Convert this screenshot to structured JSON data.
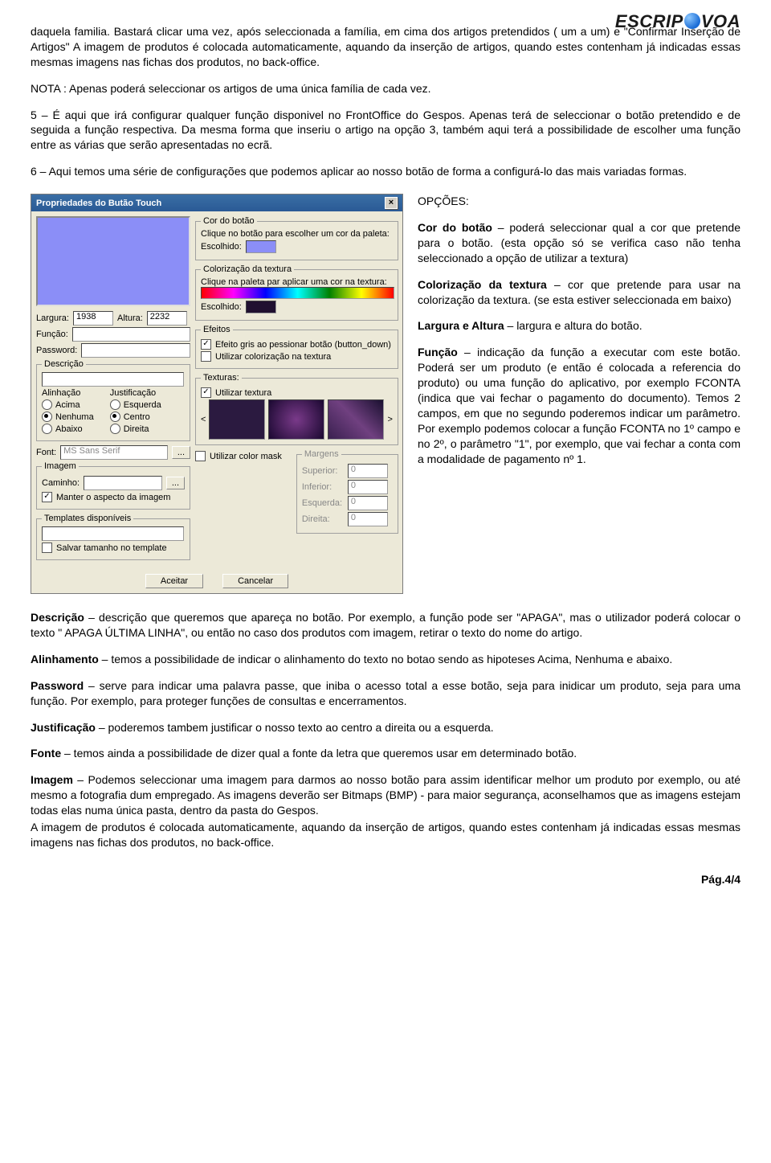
{
  "logo": "ESCRIPOVOA",
  "intro_p1": "daquela familia. Bastará clicar uma vez, após seleccionada a família, em cima dos artigos pretendidos ( um a um) e \"Confirmar Inserção de Artigos\" A imagem de produtos é colocada automaticamente, aquando da inserção de artigos, quando estes contenham já indicadas essas mesmas imagens nas fichas dos produtos, no back-office.",
  "nota": "NOTA : Apenas poderá seleccionar os artigos de uma única família de cada vez.",
  "p5": "5 – É aqui que irá configurar qualquer função disponivel no FrontOffice do Gespos. Apenas terá de seleccionar o botão pretendido e de seguida a função respectiva. Da mesma forma que inseriu o artigo na opção 3, também aqui terá a possibilidade de escolher uma função entre as várias que serão apresentadas no ecrã.",
  "p6": "6 – Aqui temos uma série de configurações que podemos aplicar ao nosso botão de forma a configurá-lo das mais variadas formas.",
  "opcoes_title": "OPÇÕES:",
  "opt_cor_t": "Cor do botão",
  "opt_cor": " – poderá seleccionar qual a cor que pretende para o botão. (esta opção só se verifica caso não tenha seleccionado a opção de utilizar a textura)",
  "opt_col_t": "Colorização da textura",
  "opt_col": " – cor que pretende para usar na colorização da textura. (se esta estiver seleccionada em baixo)",
  "opt_la_t": "Largura e Altura",
  "opt_la": " – largura e altura do botão.",
  "opt_fn_t": "Função",
  "opt_fn": " – indicação da função a executar com este botão. Poderá ser um produto (e então é colocada a referencia do produto) ou uma função do aplicativo, por exemplo FCONTA (indica que vai fechar o pagamento do documento). Temos 2 campos, em que no segundo poderemos indicar um parâmetro. Por exemplo podemos colocar a função FCONTA no 1º campo e no 2º, o parâmetro \"1\", por exemplo, que vai fechar a conta com a modalidade de pagamento nº 1.",
  "desc_t": "Descrição",
  "desc": " – descrição que queremos que apareça no botão. Por exemplo, a função pode ser \"APAGA\", mas o utilizador poderá colocar o texto \" APAGA ÚLTIMA LINHA\", ou então no caso dos produtos com imagem, retirar o texto do nome do artigo.",
  "ali_t": "Alinhamento",
  "ali": " – temos a possibilidade de indicar o alinhamento do texto no botao sendo as hipoteses Acima, Nenhuma e abaixo.",
  "pw_t": "Password",
  "pw": " – serve para indicar uma palavra passe, que iniba o acesso total a esse botão, seja para inidicar um produto, seja para uma função. Por exemplo, para proteger funções de consultas e encerramentos.",
  "just_t": "Justificação",
  "just": " – poderemos tambem justificar o nosso texto ao centro a direita ou a esquerda.",
  "font_t": "Fonte",
  "font": " – temos ainda a possibilidade de dizer qual a fonte da letra que queremos usar em determinado botão.",
  "img_t": "Imagem",
  "img1": " – Podemos seleccionar uma imagem para darmos ao nosso botão para assim identificar melhor um produto por exemplo, ou até mesmo a fotografia dum empregado. As imagens deverão ser Bitmaps (BMP) - para maior segurança, aconselhamos que as imagens estejam todas elas numa única pasta, dentro da pasta do Gespos.",
  "img2": "A imagem de produtos é colocada automaticamente, aquando da inserção de artigos, quando estes contenham já indicadas essas mesmas imagens nas fichas dos produtos, no back-office.",
  "pager": "Pág.4/4",
  "dialog": {
    "title": "Propriedades do Butão Touch",
    "largura_l": "Largura:",
    "largura_v": "1938",
    "altura_l": "Altura:",
    "altura_v": "2232",
    "funcao_l": "Função:",
    "password_l": "Password:",
    "descricao_l": "Descrição",
    "alinh_l": "Alinhação",
    "just_l": "Justificação",
    "r_acima": "Acima",
    "r_nenhuma": "Nenhuma",
    "r_abaixo": "Abaixo",
    "r_esq": "Esquerda",
    "r_centro": "Centro",
    "r_dir": "Direita",
    "font_l": "Font:",
    "font_v": "MS Sans Serif",
    "imagem_l": "Imagem",
    "caminho_l": "Caminho:",
    "manter": "Manter o aspecto da imagem",
    "cmask": "Utilizar color mask",
    "tpl_l": "Templates disponíveis",
    "salvar": "Salvar tamanho no template",
    "cor_l": "Cor do botão",
    "cor_hint": "Clique no botão para escolher um cor da paleta:",
    "escolhido": "Escolhido:",
    "colz_l": "Colorização da textura",
    "colz_hint": "Clique na paleta par aplicar uma cor na textura:",
    "ef_l": "Efeitos",
    "ef1": "Efeito gris ao pessionar botão (button_down)",
    "ef2": "Utilizar colorização na textura",
    "tex_l": "Texturas:",
    "tex_u": "Utilizar textura",
    "marg_l": "Margens",
    "m_sup": "Superior:",
    "m_inf": "Inferior:",
    "m_esq": "Esquerda:",
    "m_dir": "Direita:",
    "m_v": "0",
    "aceitar": "Aceitar",
    "cancelar": "Cancelar"
  }
}
